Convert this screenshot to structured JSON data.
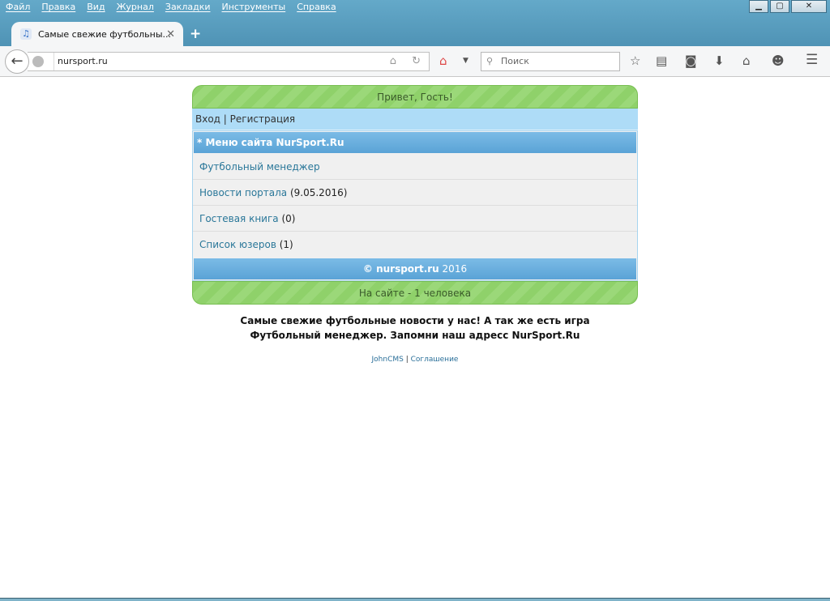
{
  "menu": [
    "Файл",
    "Правка",
    "Вид",
    "Журнал",
    "Закладки",
    "Инструменты",
    "Справка"
  ],
  "window_controls": {
    "minimize": "▁",
    "maximize": "▢",
    "close": "✕"
  },
  "tab": {
    "title": "Самые свежие футбольны...",
    "close": "✕",
    "new": "+"
  },
  "address": {
    "url": "nursport.ru"
  },
  "search": {
    "placeholder": "Поиск"
  },
  "page": {
    "greeting": "Привет, Гость!",
    "login": "Вход",
    "sep": " | ",
    "register": "Регистрация",
    "menu_title": "* Меню сайта NurSport.Ru",
    "items": [
      {
        "label": "Футбольный менеджер",
        "extra": ""
      },
      {
        "label": "Новости портала",
        "extra": " (9.05.2016)"
      },
      {
        "label": "Гостевая книга",
        "extra": " (0)"
      },
      {
        "label": "Список юзеров",
        "extra": " (1)"
      }
    ],
    "footer_site": "© nursport.ru",
    "footer_year": " 2016",
    "online": "На сайте - 1 человека",
    "description": "Самые свежие футбольные новости у нас! А так же есть игра Футбольный менеджер. Запомни наш адресс NurSport.Ru",
    "link1": "JohnCMS",
    "link_sep": " | ",
    "link2": "Соглашение"
  }
}
